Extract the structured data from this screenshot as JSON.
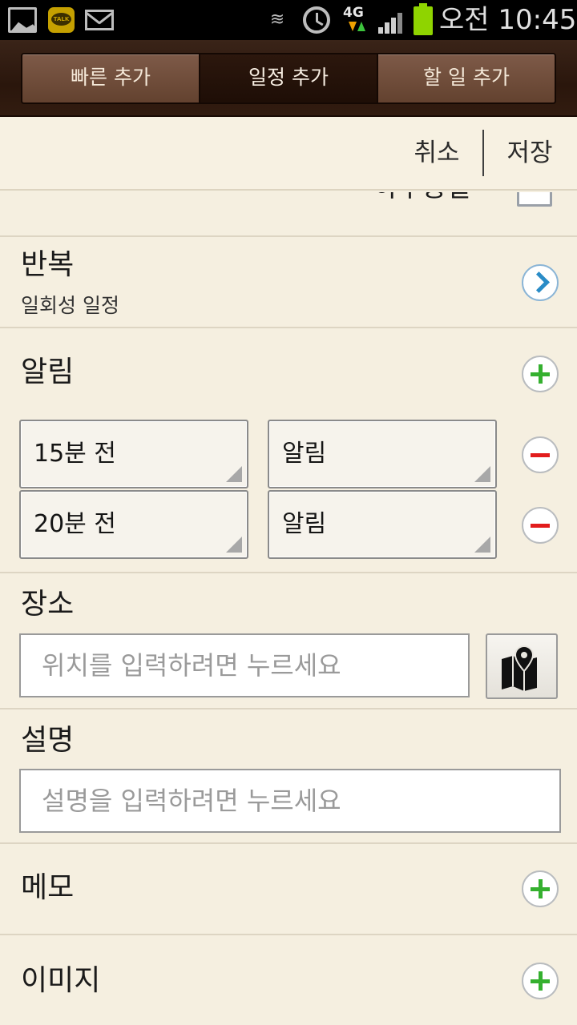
{
  "status_bar": {
    "time": "오전 10:45",
    "network": "4G",
    "icons": [
      "gallery-icon",
      "kakaotalk-icon",
      "mail-icon",
      "vibrate-icon",
      "alarm-icon",
      "network-4g-icon",
      "signal-icon",
      "battery-icon"
    ],
    "talk_badge": "TALK"
  },
  "tabs": [
    {
      "label": "빠른 추가",
      "active": false
    },
    {
      "label": "일정 추가",
      "active": true
    },
    {
      "label": "할 일 추가",
      "active": false
    }
  ],
  "action_bar": {
    "cancel_label": "취소",
    "save_label": "저장"
  },
  "all_day": {
    "label": "하루종일",
    "checked": false
  },
  "repeat": {
    "label": "반복",
    "value": "일회성 일정"
  },
  "reminder": {
    "label": "알림",
    "items": [
      {
        "time": "15분 전",
        "type": "알림"
      },
      {
        "time": "20분 전",
        "type": "알림"
      }
    ]
  },
  "location": {
    "label": "장소",
    "placeholder": "위치를 입력하려면 누르세요"
  },
  "description": {
    "label": "설명",
    "placeholder": "설명을 입력하려면 누르세요"
  },
  "memo": {
    "label": "메모"
  },
  "image": {
    "label": "이미지"
  },
  "colors": {
    "accent_blue": "#2a8cc7",
    "add_green": "#35b02f",
    "remove_red": "#e21c1c",
    "header_brown": "#2a160c",
    "paper_background": "#f5efe0"
  }
}
